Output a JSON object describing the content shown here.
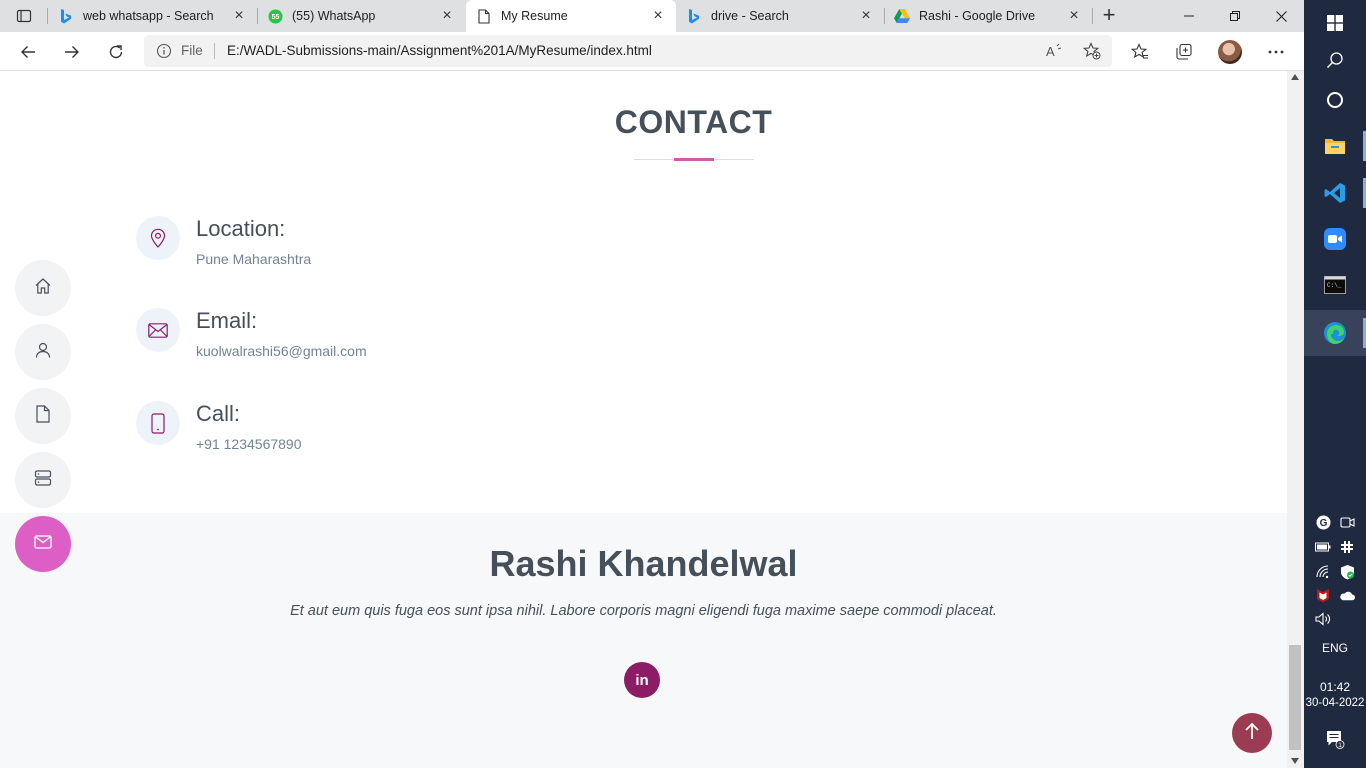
{
  "browser": {
    "tabs": [
      {
        "title": "web whatsapp - Search",
        "icon": "bing-icon",
        "active": false
      },
      {
        "title": "(55) WhatsApp",
        "icon": "whatsapp-icon",
        "active": false
      },
      {
        "title": "My Resume",
        "icon": "page-icon",
        "active": true
      },
      {
        "title": "drive - Search",
        "icon": "bing-icon",
        "active": false
      },
      {
        "title": "Rashi - Google Drive",
        "icon": "google-drive-icon",
        "active": false
      }
    ],
    "address": {
      "scheme_label": "File",
      "url": "E:/WADL-Submissions-main/Assignment%201A/MyResume/index.html"
    }
  },
  "contact": {
    "title": "CONTACT",
    "items": [
      {
        "label": "Location:",
        "value": "Pune Maharashtra",
        "icon": "map-pin-icon"
      },
      {
        "label": "Email:",
        "value": "kuolwalrashi56@gmail.com",
        "icon": "envelope-icon"
      },
      {
        "label": "Call:",
        "value": "+91 1234567890",
        "icon": "phone-icon"
      }
    ]
  },
  "footer": {
    "name": "Rashi Khandelwal",
    "tagline": "Et aut eum quis fuga eos sunt ipsa nihil. Labore corporis magni eligendi fuga maxime saepe commodi placeat.",
    "social": [
      {
        "label": "in",
        "icon": "linkedin-icon"
      }
    ]
  },
  "sidenav": [
    {
      "icon": "home-icon",
      "active": false
    },
    {
      "icon": "user-icon",
      "active": false
    },
    {
      "icon": "file-icon",
      "active": false
    },
    {
      "icon": "server-icon",
      "active": false
    },
    {
      "icon": "envelope-icon",
      "active": true
    }
  ],
  "taskbar": {
    "language": "ENG",
    "time": "01:42",
    "date": "30-04-2022",
    "notification_count": "1"
  },
  "colors": {
    "accent_pink": "#dd5ec5",
    "title_accent": "#c95eaa",
    "linkedin_bg": "#8c1c66",
    "back_to_top": "#9c3c52",
    "heading_text": "#45505b",
    "taskbar_bg": "#1f2a40"
  }
}
